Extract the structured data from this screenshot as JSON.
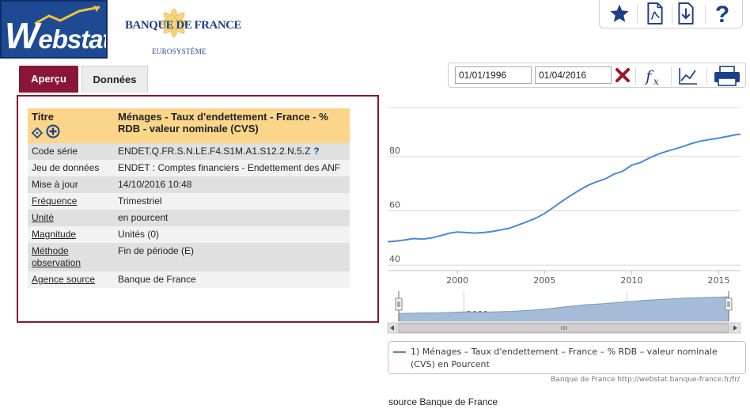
{
  "logos": {
    "webstat": "Webstat",
    "bdf_name": "BANQUE DE FRANCE",
    "bdf_sub": "EUROSYSTÈME"
  },
  "toolbar_icons": [
    "star-icon",
    "pdf-icon",
    "download-icon",
    "help-icon"
  ],
  "tabs": [
    {
      "label": "Aperçu",
      "active": true
    },
    {
      "label": "Données",
      "active": false
    }
  ],
  "info": {
    "title_label": "Titre",
    "title_value": "Ménages - Taux d'endettement - France - % RDB - valeur nominale (CVS)",
    "rows": [
      {
        "key": "Code série",
        "value": "ENDET.Q.FR.S.N.LE.F4.S1M.A1.S12.2.N.5.Z",
        "link": false
      },
      {
        "key": "Jeu de données",
        "value": "ENDET : Comptes financiers - Endettement des ANF",
        "link": false
      },
      {
        "key": "Mise à jour",
        "value": "14/10/2016 10:48",
        "link": false
      },
      {
        "key": "Fréquence",
        "value": "Trimestriel",
        "link": true
      },
      {
        "key": "Unité",
        "value": "en pourcent",
        "link": true
      },
      {
        "key": "Magnitude",
        "value": "Unités (0)",
        "link": true
      },
      {
        "key": "Méthode observation",
        "value": "Fin de période (E)",
        "link": true
      },
      {
        "key": "Agence source",
        "value": "Banque de France",
        "link": true
      }
    ],
    "help_mark": "?"
  },
  "dates": {
    "start": "01/01/1996",
    "end": "01/04/2016"
  },
  "chart_data": {
    "type": "line",
    "x_range": [
      1996,
      2016.25
    ],
    "ylim": [
      38,
      98
    ],
    "yticks": [
      40,
      60,
      80
    ],
    "xticks": [
      2000,
      2005,
      2010,
      2015
    ],
    "navigator_ticks": [
      2000,
      2010
    ],
    "grid": true,
    "series": [
      {
        "name": "1) Ménages - Taux d'endettement - France - % RDB - valeur nominale (CVS) en Pourcent",
        "color": "#4a8ad6",
        "x": [
          1996,
          1996.5,
          1997,
          1997.5,
          1998,
          1998.5,
          1999,
          1999.5,
          2000,
          2000.5,
          2001,
          2001.5,
          2002,
          2002.5,
          2003,
          2003.5,
          2004,
          2004.5,
          2005,
          2005.5,
          2006,
          2006.5,
          2007,
          2007.5,
          2008,
          2008.5,
          2009,
          2009.5,
          2010,
          2010.5,
          2011,
          2011.5,
          2012,
          2012.5,
          2013,
          2013.5,
          2014,
          2014.5,
          2015,
          2015.5,
          2016,
          2016.25
        ],
        "values": [
          48.6,
          48.9,
          49.3,
          49.8,
          49.6,
          50.0,
          50.8,
          51.7,
          52.2,
          52.0,
          51.8,
          52.0,
          52.4,
          53.0,
          53.6,
          54.8,
          56.0,
          57.3,
          59.0,
          61.2,
          63.5,
          65.6,
          67.6,
          69.4,
          70.7,
          71.8,
          73.5,
          74.6,
          76.8,
          77.8,
          79.4,
          80.8,
          81.9,
          82.8,
          83.8,
          84.9,
          85.7,
          86.3,
          86.8,
          87.4,
          88.0,
          88.2
        ]
      }
    ]
  },
  "legend_text": "1) Ménages – Taux d'endettement – France – % RDB – valeur nominale (CVS) en Pourcent",
  "credit": "Banque de France http://webstat.banque-france.fr/fr/",
  "source": "source Banque de France"
}
